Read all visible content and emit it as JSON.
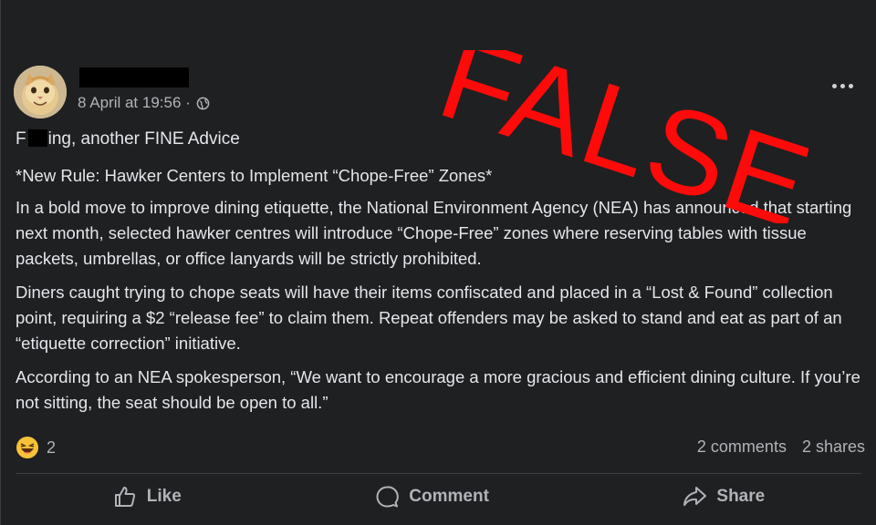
{
  "post": {
    "timestamp": "8 April at 19:56 ·",
    "line1_prefix": "F",
    "line1_suffix": "ing, another FINE Advice",
    "headline": "*New Rule: Hawker Centers to Implement “Chope-Free” Zones*",
    "para1": "In a bold move to improve dining etiquette, the National Environment Agency (NEA) has announced that starting next month, selected hawker centres will introduce “Chope-Free” zones where reserving tables with tissue packets, umbrellas, or office lanyards will be strictly prohibited.",
    "para2": "Diners caught trying to chope seats will have their items confiscated and placed in a “Lost & Found” collection point, requiring a $2 “release fee” to claim them. Repeat offenders may be asked to stand and eat as part of an “etiquette correction” initiative.",
    "para3": "According to an NEA spokesperson, “We want to encourage a more gracious and efficient dining culture. If you’re not sitting, the seat should be open to all.”"
  },
  "stats": {
    "reaction_count": "2",
    "comments": "2 comments",
    "shares": "2 shares"
  },
  "actions": {
    "like": "Like",
    "comment": "Comment",
    "share": "Share"
  },
  "stamp": {
    "text": "FALSE",
    "color": "#ff0a0a"
  },
  "icons": [
    "globe-icon",
    "more-options-icon",
    "laughing-emoji-icon",
    "thumbs-up-icon",
    "comment-bubble-icon",
    "share-arrow-icon"
  ]
}
